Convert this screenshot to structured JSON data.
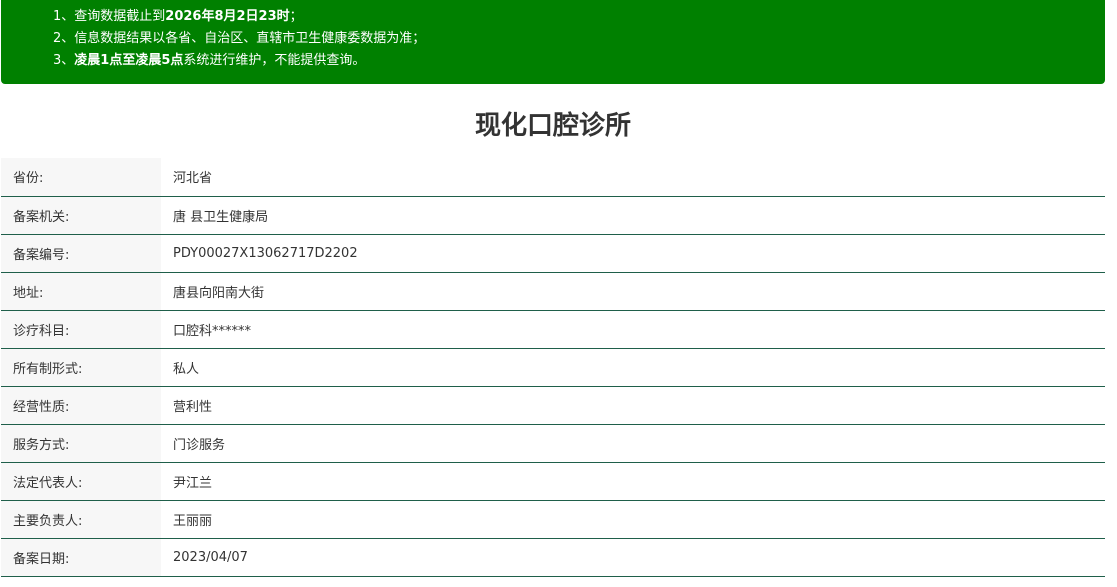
{
  "notice": {
    "line1": {
      "prefix": "1、查询数据截止到",
      "bold": "2026年8月2日23时",
      "suffix": "；"
    },
    "line2": "2、信息数据结果以各省、自治区、直辖市卫生健康委数据为准；",
    "line3": {
      "prefix": "3、",
      "bold": "凌晨1点至凌晨5点",
      "suffix": "系统进行维护，不能提供查询。"
    }
  },
  "title": "现化口腔诊所",
  "rows": [
    {
      "label": "省份:",
      "value": "河北省"
    },
    {
      "label": "备案机关:",
      "value": "唐 县卫生健康局"
    },
    {
      "label": "备案编号:",
      "value": "PDY00027X13062717D2202"
    },
    {
      "label": "地址:",
      "value": "唐县向阳南大街"
    },
    {
      "label": "诊疗科目:",
      "value": "口腔科******"
    },
    {
      "label": "所有制形式:",
      "value": "私人"
    },
    {
      "label": "经营性质:",
      "value": "营利性"
    },
    {
      "label": "服务方式:",
      "value": "门诊服务"
    },
    {
      "label": "法定代表人:",
      "value": "尹江兰"
    },
    {
      "label": "主要负责人:",
      "value": "王丽丽"
    },
    {
      "label": "备案日期:",
      "value": "2023/04/07"
    }
  ],
  "colors": {
    "notice_bg": "#008000",
    "row_border": "#1f5f4a",
    "label_bg": "#f7f7f7"
  }
}
